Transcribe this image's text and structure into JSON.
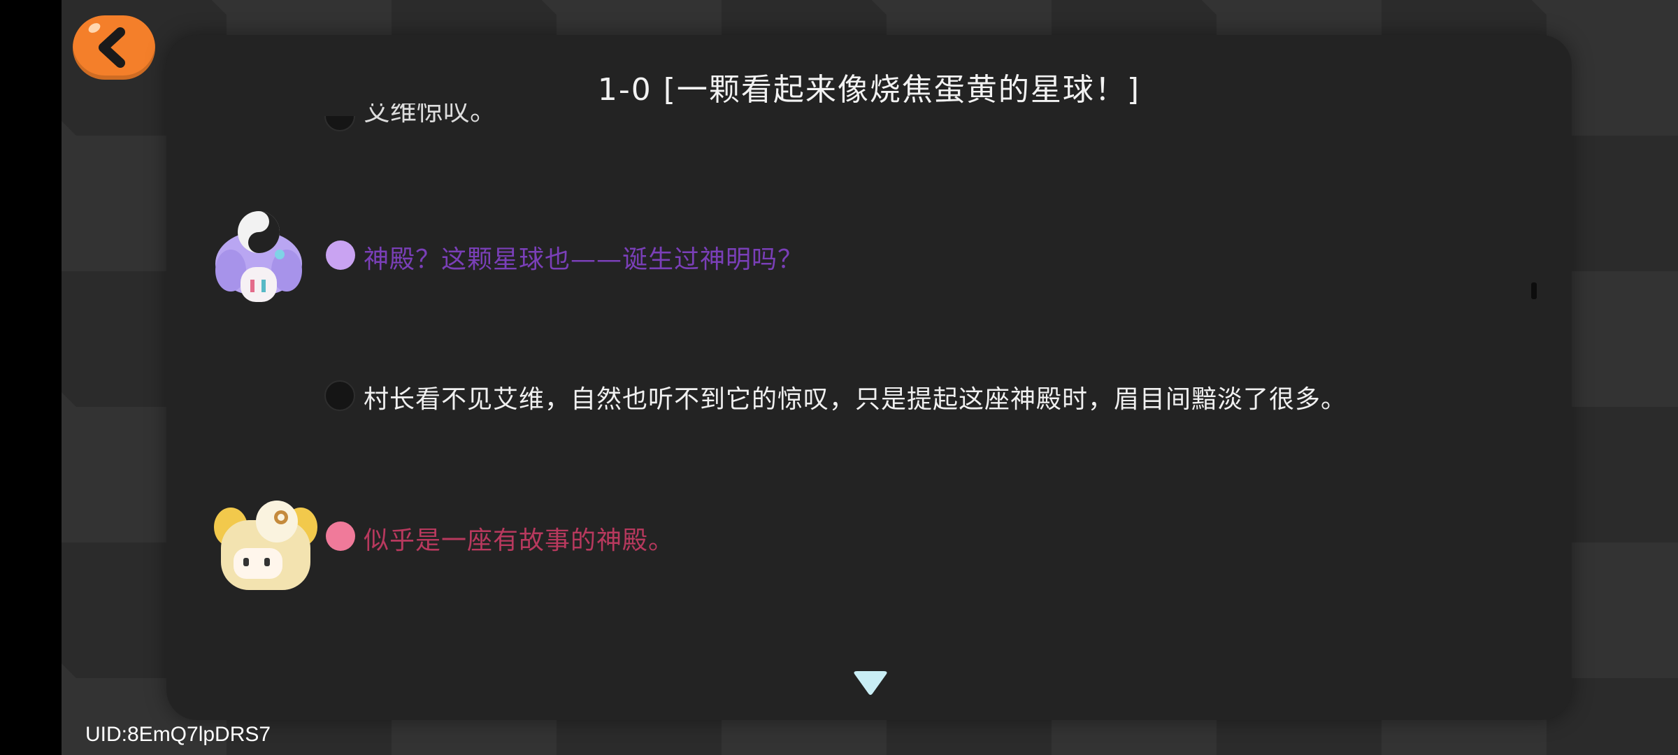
{
  "header": {
    "title": "1-0 [一颗看起来像烧焦蛋黄的星球！]",
    "back_icon": "chevron-left-icon"
  },
  "dialogue": {
    "partial_line": "艾维惊叹。",
    "lines": [
      {
        "speaker": "purple-haired-character",
        "dot_color": "#c9a3f2",
        "text": "神殿？这颗星球也——诞生过神明吗？",
        "color": "#7a3fb8"
      },
      {
        "speaker": "narrator",
        "dot_color": "#151515",
        "text": "村长看不见艾维，自然也听不到它的惊叹，只是提起这座神殿时，眉目间黯淡了很多。",
        "color": "#f0f0f0"
      },
      {
        "speaker": "blonde-character",
        "dot_color": "#f07a9a",
        "text": "似乎是一座有故事的神殿。",
        "color": "#b8395e"
      }
    ],
    "continue_icon": "triangle-down-icon"
  },
  "footer": {
    "uid": "UID:8EmQ7lpDRS7"
  }
}
